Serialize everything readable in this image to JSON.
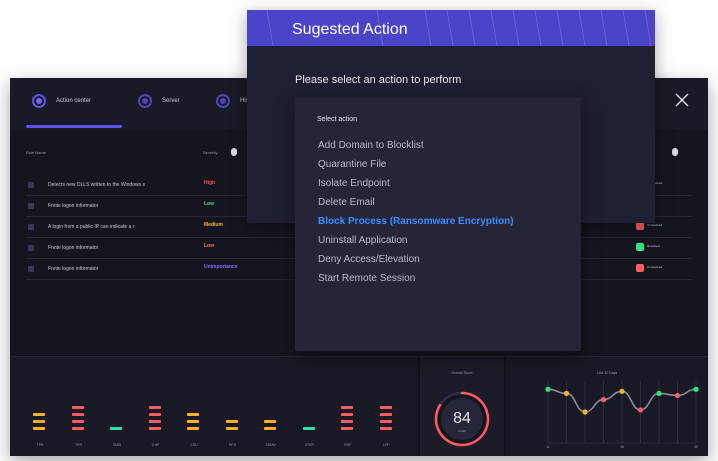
{
  "app": {
    "tabs": [
      {
        "label": "Action center"
      },
      {
        "label": "Server"
      },
      {
        "label": "Hist"
      }
    ],
    "table": {
      "headers": {
        "name": "Rule Name",
        "severity": "Severity"
      },
      "rows": [
        {
          "name": "Detects new DLLS written to the Windows s",
          "severity": "High",
          "severity_color": "#ff4d4d",
          "status": "Unresolved",
          "status_color": "#ff5a5f"
        },
        {
          "name": "Fnnte logon informator",
          "severity": "Low",
          "severity_color": "#3ddc84",
          "status": "",
          "status_color": ""
        },
        {
          "name": "A login from a public IP can indicate a r",
          "severity": "Medium",
          "severity_color": "#ffb020",
          "status": "Unresolved",
          "status_color": "#ff5a5f"
        },
        {
          "name": "Fnnte logon informator",
          "severity": "Low",
          "severity_color": "#ff7a45",
          "status": "Resolved",
          "status_color": "#2ee37a"
        },
        {
          "name": "Fnnte logon informator",
          "severity": "Unimportance",
          "severity_color": "#7b6dff",
          "status": "Unresolved",
          "status_color": "#ff5a5f"
        }
      ]
    },
    "equalizer": [
      {
        "label": "TPR",
        "color": "#ffb020",
        "bars": 3
      },
      {
        "label": "TPR",
        "color": "#ff5a5f",
        "bars": 4
      },
      {
        "label": "VNID",
        "color": "#2ee3a0",
        "bars": 1
      },
      {
        "label": "D dP",
        "color": "#ff5a5f",
        "bars": 4
      },
      {
        "label": "CSU",
        "color": "#ffb020",
        "bars": 3
      },
      {
        "label": "EFS",
        "color": "#ffb020",
        "bars": 2
      },
      {
        "label": "NGAV",
        "color": "#ffb020",
        "bars": 2
      },
      {
        "label": "2TEP",
        "color": "#2ee3a0",
        "bars": 1
      },
      {
        "label": "RSP",
        "color": "#ff5a5f",
        "bars": 4
      },
      {
        "label": "LFP",
        "color": "#ff5a5f",
        "bars": 4
      }
    ],
    "score": {
      "title": "Overall Score",
      "value": "84",
      "sub": "Low",
      "fraction": 0.84
    },
    "trend": {
      "title": "Last 30 Days",
      "x_ticks": [
        "11",
        "16",
        "30"
      ],
      "values": [
        52,
        48,
        30,
        42,
        50,
        32,
        48,
        46,
        52
      ],
      "colors": [
        "#2ee37a",
        "#ffb020",
        "#ffb020",
        "#ff5a5f",
        "#ffb020",
        "#ff5a5f",
        "#2ee37a",
        "#ff5a5f",
        "#2ee37a"
      ]
    }
  },
  "modal": {
    "title": "Sugested Action",
    "prompt": "Please select an action to perform"
  },
  "dropdown": {
    "label": "Select action",
    "items": [
      {
        "label": "Add Domain to Blocklist",
        "selected": false
      },
      {
        "label": "Quarantine File",
        "selected": false
      },
      {
        "label": "Isolate Endpoint",
        "selected": false
      },
      {
        "label": "Delete Email",
        "selected": false
      },
      {
        "label": "Block Process (Ransomware Encryption)",
        "selected": true
      },
      {
        "label": "Uninstall Application",
        "selected": false
      },
      {
        "label": "Deny Access/Elevation",
        "selected": false
      },
      {
        "label": "Start Remote Session",
        "selected": false
      }
    ]
  },
  "colors": {
    "accent": "#4b43c8",
    "selected_item": "#3b8cff",
    "panel": "#1f1f33"
  }
}
